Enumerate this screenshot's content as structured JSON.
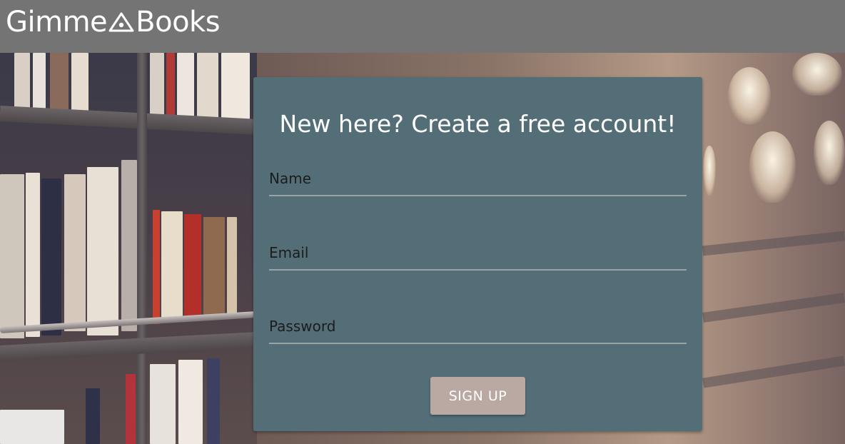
{
  "header": {
    "brand_left": "Gimme",
    "brand_right": "Books",
    "brand_icon": "triangle-eye-icon"
  },
  "signup": {
    "title": "New here? Create a free account!",
    "name_placeholder": "Name",
    "email_placeholder": "Email",
    "password_placeholder": "Password",
    "submit_label": "SIGN UP"
  },
  "colors": {
    "topbar": "#747474",
    "card": "#546e78",
    "button": "#baa8a2",
    "text_light": "#ffffff",
    "field_text": "#1c1c1c",
    "field_underline": "#9aa4a6"
  },
  "background": {
    "description_icon": "bookshelf-photo"
  }
}
